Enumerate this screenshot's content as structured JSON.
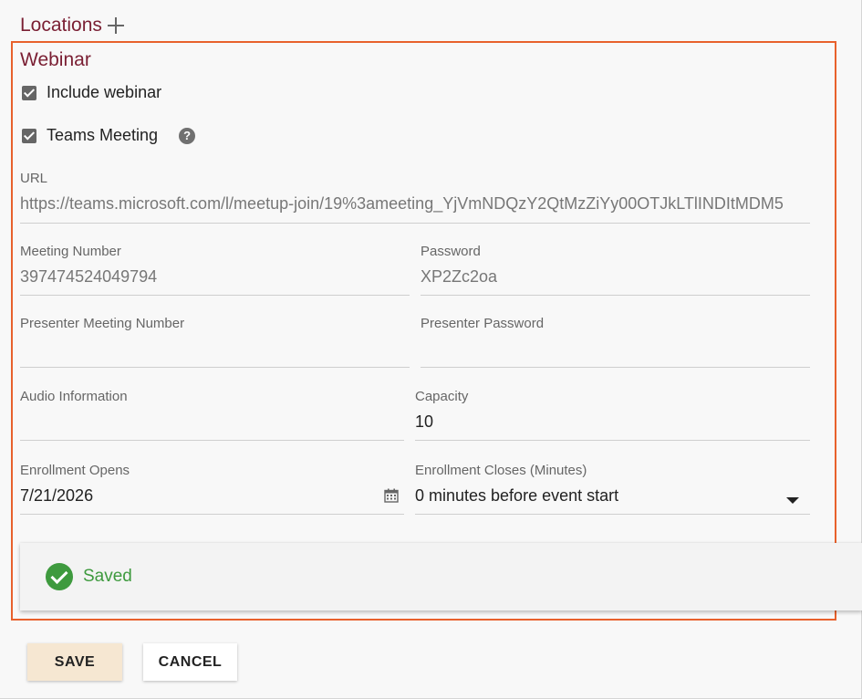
{
  "locations": {
    "title": "Locations"
  },
  "webinar": {
    "title": "Webinar",
    "include_webinar_label": "Include webinar",
    "teams_meeting_label": "Teams Meeting",
    "help_glyph": "?"
  },
  "fields": {
    "url": {
      "label": "URL",
      "value": "https://teams.microsoft.com/l/meetup-join/19%3ameeting_YjVmNDQzY2QtMzZiYy00OTJkLTlINDItMDM5"
    },
    "meeting_number": {
      "label": "Meeting Number",
      "value": "397474524049794"
    },
    "password": {
      "label": "Password",
      "value": "XP2Zc2oa"
    },
    "presenter_meeting_number": {
      "label": "Presenter Meeting Number",
      "value": ""
    },
    "presenter_password": {
      "label": "Presenter Password",
      "value": ""
    },
    "audio_information": {
      "label": "Audio Information",
      "value": ""
    },
    "capacity": {
      "label": "Capacity",
      "value": "10"
    },
    "enrollment_opens": {
      "label": "Enrollment Opens",
      "value": "7/21/2026"
    },
    "enrollment_closes": {
      "label": "Enrollment Closes (Minutes)",
      "value": "0 minutes before event start"
    }
  },
  "toast": {
    "text": "Saved"
  },
  "buttons": {
    "save": "SAVE",
    "cancel": "CANCEL"
  },
  "icons": {
    "add": "plus-icon",
    "help": "help-icon",
    "calendar": "calendar-icon",
    "dropdown": "chevron-down-icon",
    "success": "check-circle-icon"
  },
  "colors": {
    "section_title": "#7a1f33",
    "highlight_border": "#e8612c",
    "success": "#3e9a3e",
    "save_button_bg": "#f6e7d2"
  }
}
